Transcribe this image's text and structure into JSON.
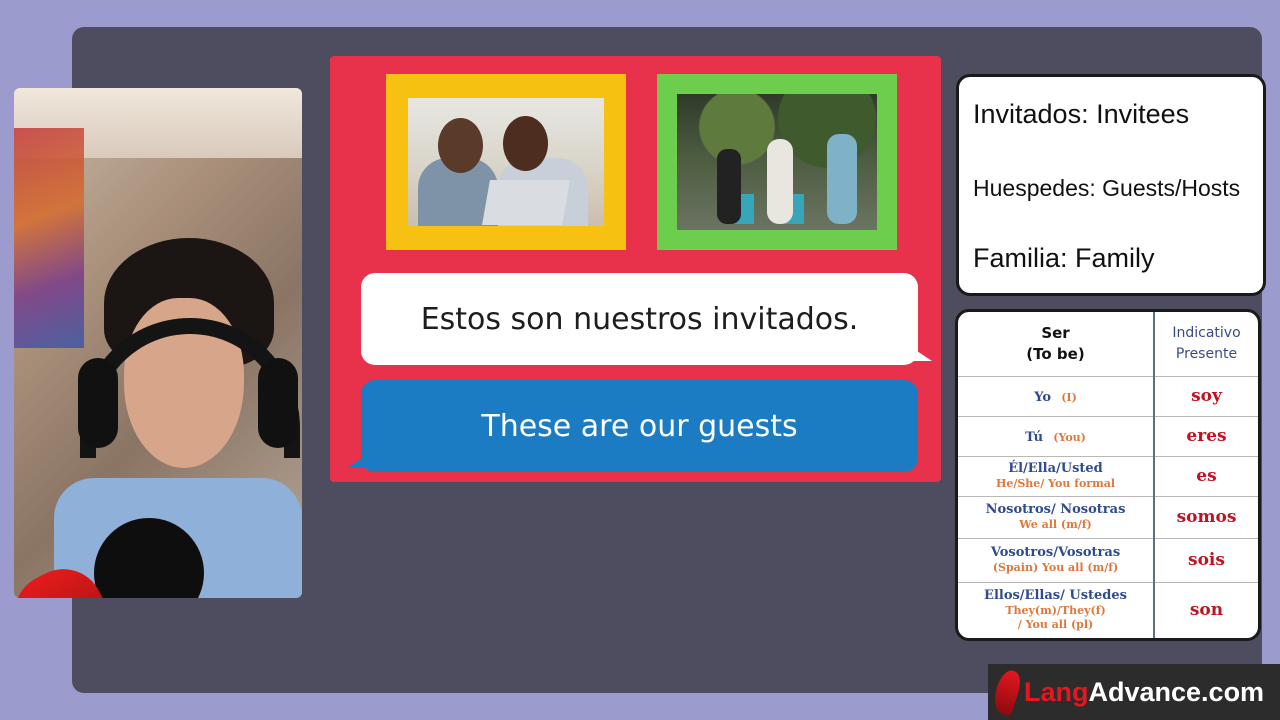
{
  "lesson": {
    "images": [
      {
        "icon": "family-photo",
        "frame_color": "#f7c111"
      },
      {
        "icon": "party-guests-photo",
        "frame_color": "#6dce4d"
      }
    ],
    "spanish_sentence": "Estos son nuestros invitados.",
    "english_sentence": "These are our guests",
    "card_color": "#e8314a",
    "blue_bubble_color": "#1b7cc3"
  },
  "vocab": {
    "items": [
      "Invitados: Invitees",
      "Huespedes: Guests/Hosts",
      "Familia: Family"
    ]
  },
  "conjugation": {
    "header_left_line1": "Ser",
    "header_left_line2": "(To be)",
    "header_right_line1": "Indicativo",
    "header_right_line2": "Presente",
    "rows": [
      {
        "pronoun": "Yo",
        "english": "(I)",
        "form": "soy"
      },
      {
        "pronoun": "Tú",
        "english": "(You)",
        "form": "eres"
      },
      {
        "pronoun": "Él/Ella/Usted",
        "english": "He/She/ You formal",
        "form": "es"
      },
      {
        "pronoun": "Nosotros/ Nosotras",
        "english": "We all (m/f)",
        "form": "somos"
      },
      {
        "pronoun": "Vosotros/Vosotras",
        "english": "(Spain) You all (m/f)",
        "form": "sois"
      },
      {
        "pronoun": "Ellos/Ellas/ Ustedes",
        "english_line1": "They(m)/They(f)",
        "english_line2": "/ You all (pl)",
        "form": "son"
      }
    ]
  },
  "brand": {
    "prefix": "Lang",
    "suffix": "Advance.com"
  }
}
